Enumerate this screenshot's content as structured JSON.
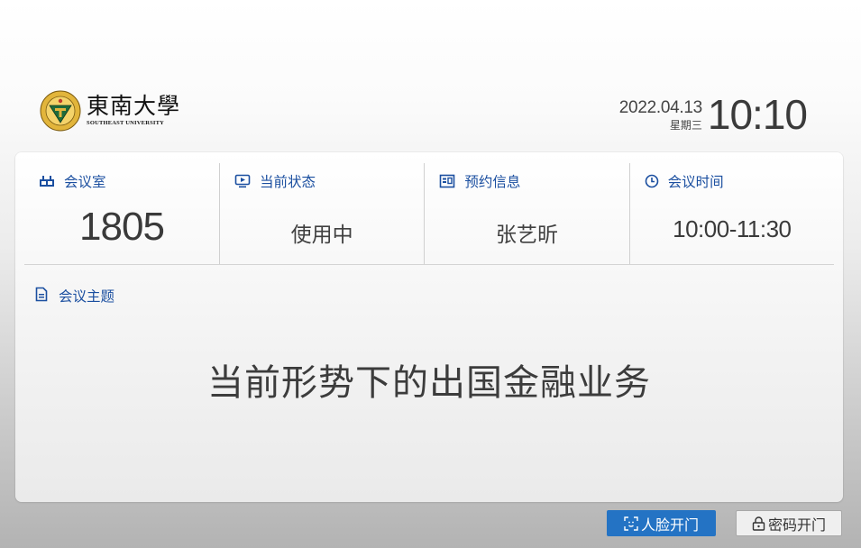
{
  "header": {
    "logo": {
      "name_cn": "東南大學",
      "name_en": "SOUTHEAST UNIVERSITY",
      "seal_text": "東南大學"
    },
    "date": "2022.04.13",
    "weekday": "星期三",
    "time": "10:10"
  },
  "info": {
    "room": {
      "label": "会议室",
      "value": "1805",
      "icon": "building-icon"
    },
    "status": {
      "label": "当前状态",
      "value": "使用中",
      "icon": "play-screen-icon"
    },
    "booking": {
      "label": "预约信息",
      "value": "张艺昕",
      "icon": "id-card-icon"
    },
    "meeting_time": {
      "label": "会议时间",
      "value": "10:00-11:30",
      "icon": "clock-icon"
    }
  },
  "topic": {
    "label": "会议主题",
    "icon": "document-icon",
    "value": "当前形势下的出国金融业务"
  },
  "actions": {
    "face_unlock": {
      "label": "人脸开门",
      "icon": "face-scan-icon"
    },
    "password_unlock": {
      "label": "密码开门",
      "icon": "lock-icon"
    }
  },
  "colors": {
    "accent": "#1b4fa0",
    "button_primary": "#2473c4",
    "seal_gold": "#e2b53b",
    "seal_green": "#1f6b3a"
  }
}
